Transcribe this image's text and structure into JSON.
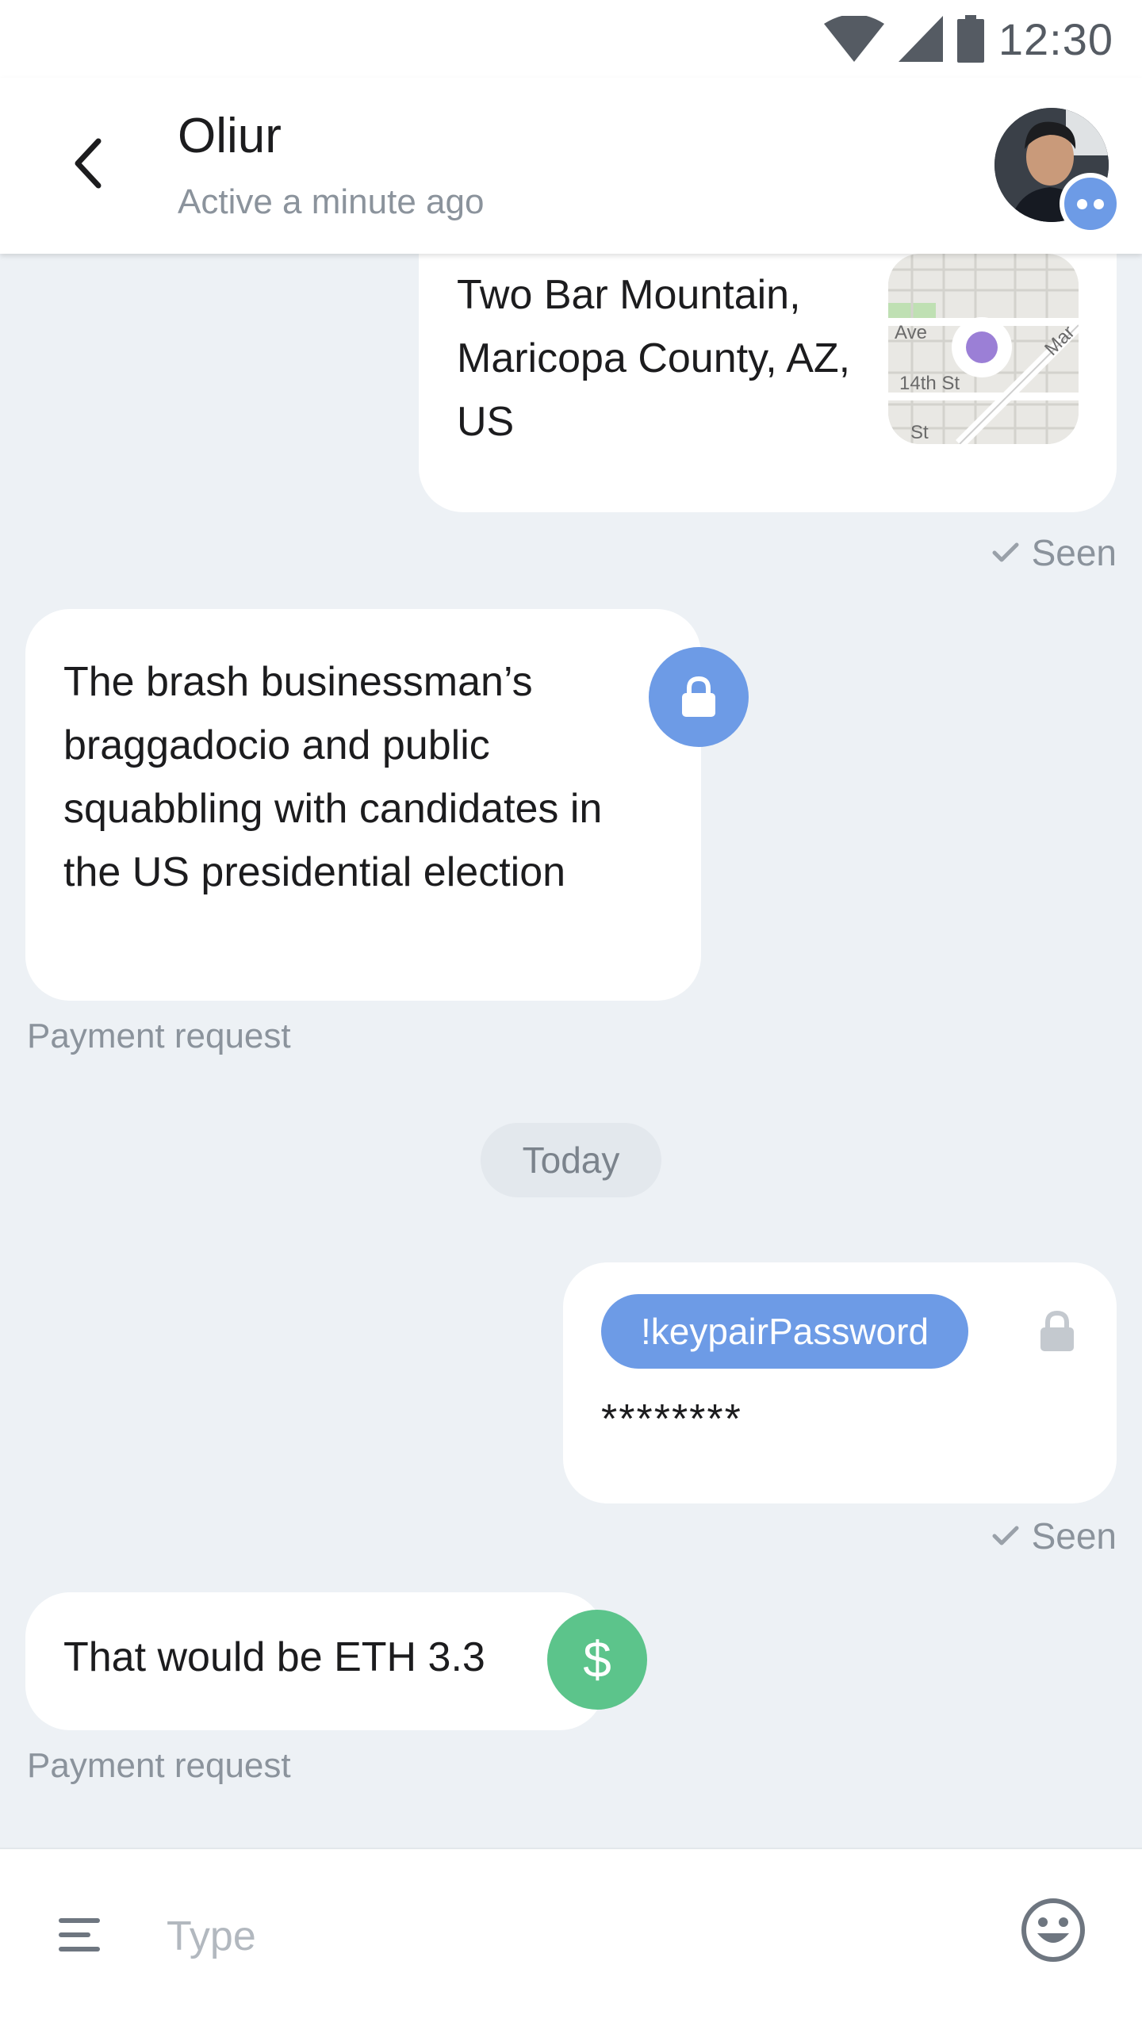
{
  "status_bar": {
    "time": "12:30"
  },
  "header": {
    "contact_name": "Oliur",
    "contact_status": "Active a minute ago"
  },
  "messages": {
    "location": {
      "address": "Two Bar Mountain, Maricopa County, AZ, US",
      "map_labels": {
        "street_1": "Ave",
        "street_2": "14th St",
        "street_3": "Mar",
        "street_4": "St"
      }
    },
    "seen_1": "Seen",
    "encrypted_text": "The brash businessman’s braggadocio and public squabbling with candidates in the US presidential election",
    "caption_1": "Payment request",
    "date_separator": "Today",
    "command": {
      "tag": "!keypairPassword",
      "masked_value": "********"
    },
    "seen_2": "Seen",
    "payment": {
      "text": "That would be ETH 3.3",
      "icon_glyph": "$"
    },
    "caption_2": "Payment request"
  },
  "input": {
    "placeholder": "Type",
    "value": ""
  },
  "colors": {
    "accent_blue": "#6d9be6",
    "payment_green": "#5cc48b",
    "chat_bg": "#edf1f5"
  }
}
